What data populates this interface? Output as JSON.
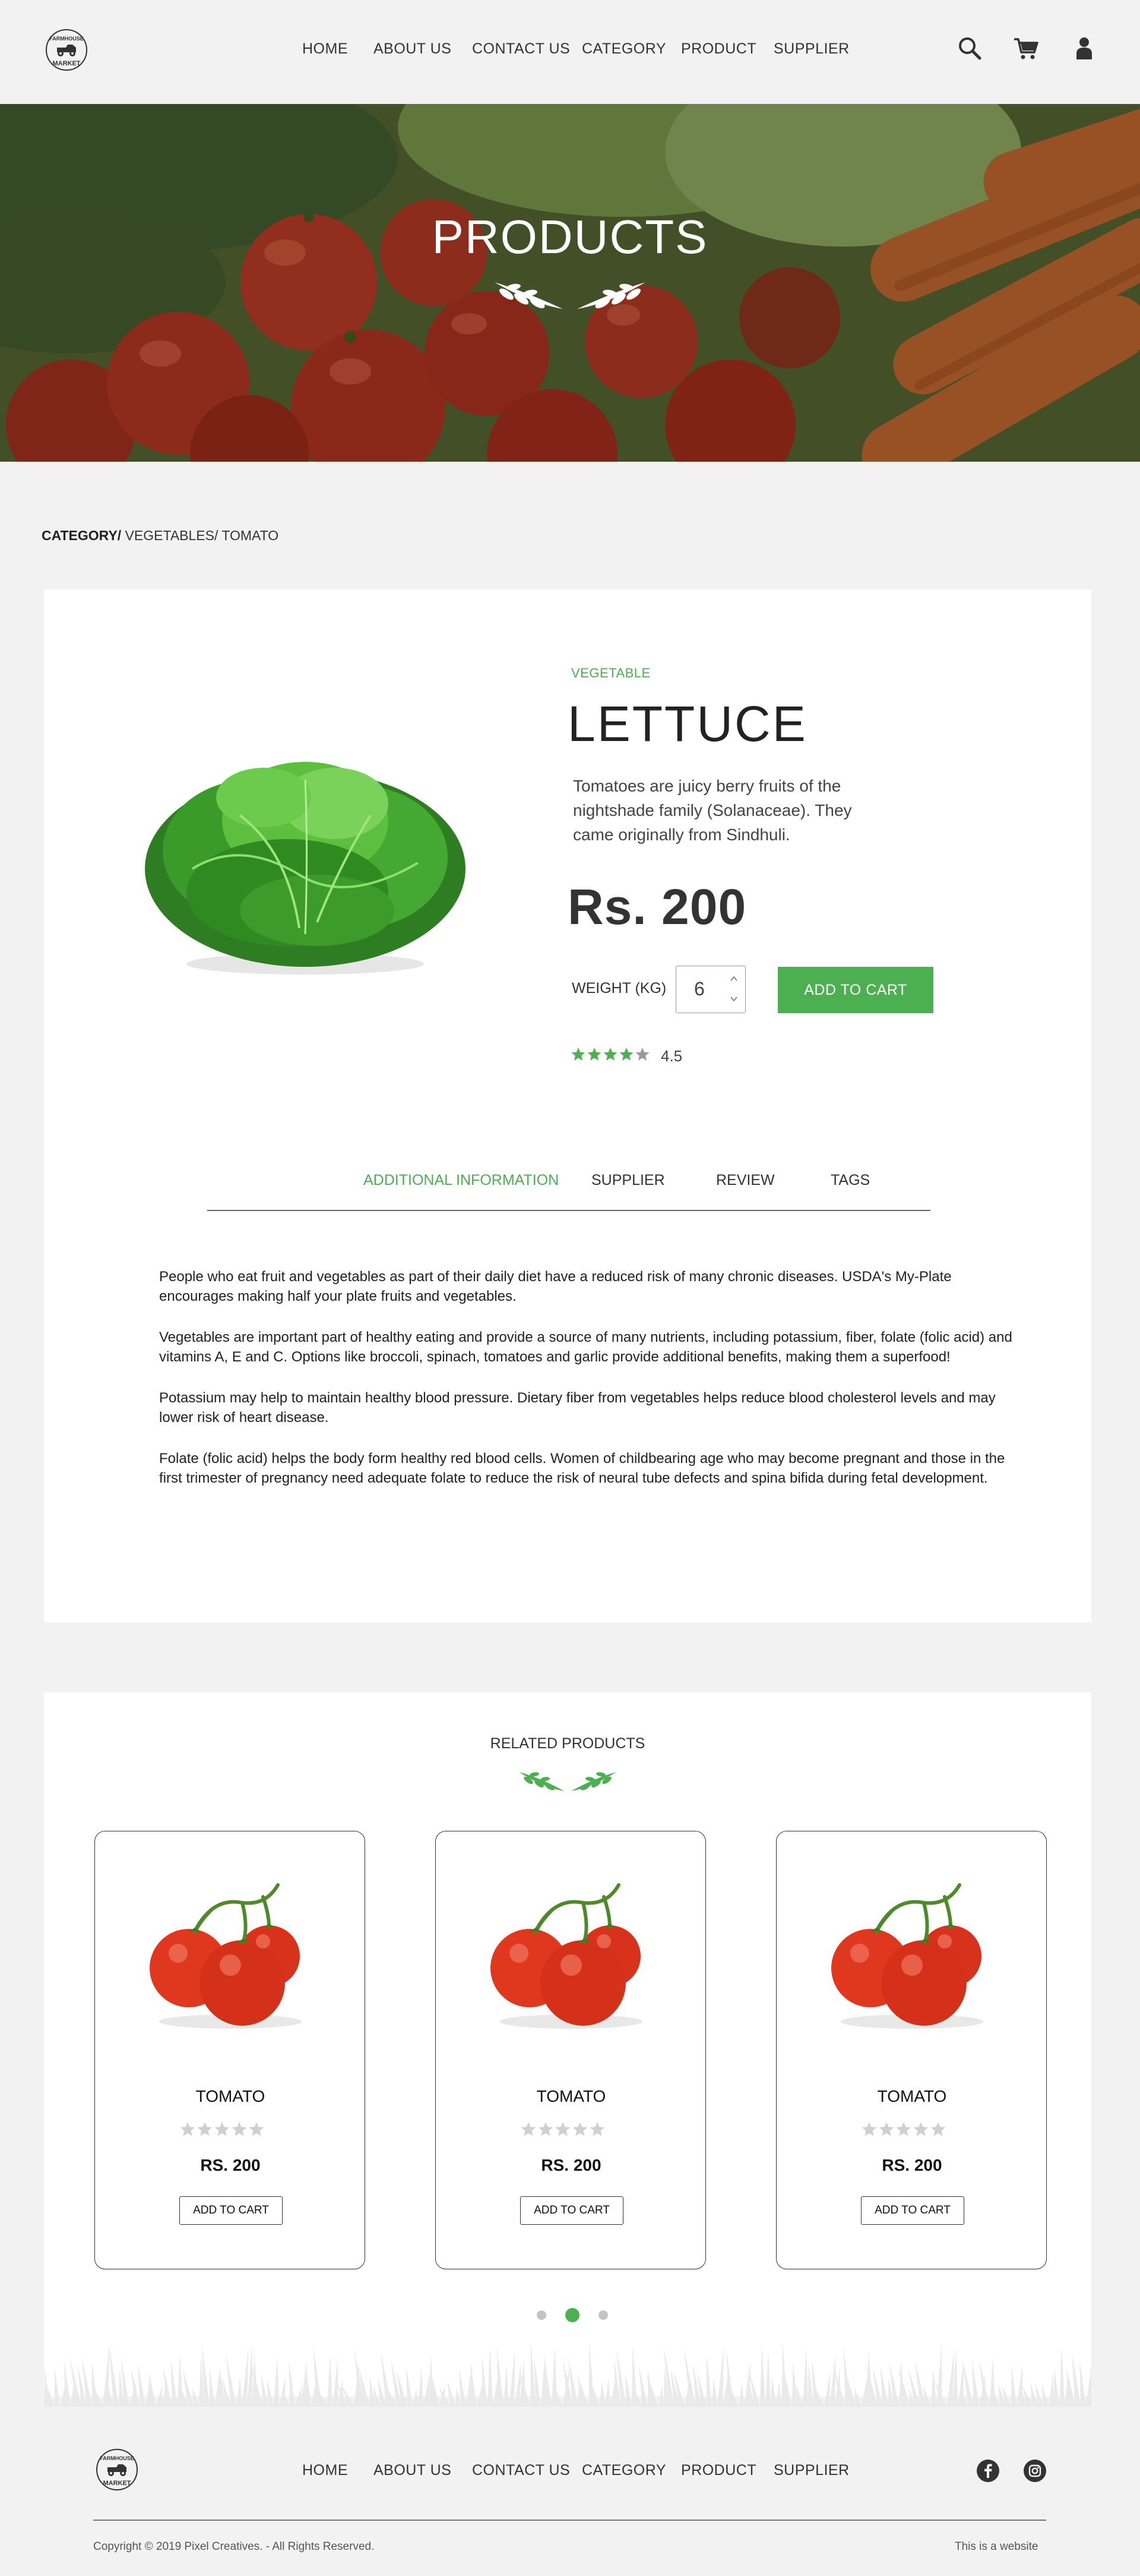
{
  "brand": {
    "logo_text_top": "FARMHOUSE",
    "logo_text_bottom": "MARKET"
  },
  "nav": {
    "home": "HOME",
    "about": "ABOUT US",
    "contact": "CONTACT US",
    "category": "CATEGORY",
    "product": "PRODUCT",
    "supplier": "SUPPLIER"
  },
  "header_icons": [
    "search-icon",
    "cart-icon",
    "user-icon"
  ],
  "hero": {
    "title": "PRODUCTS"
  },
  "breadcrumb": {
    "root": "CATEGORY/",
    "trail": " VEGETABLES/ TOMATO"
  },
  "product": {
    "category": "VEGETABLE",
    "name": "LETTUCE",
    "description": "Tomatoes are juicy berry fruits of the nightshade family (Solanaceae). They came originally from Sindhuli.",
    "price": "Rs. 200",
    "weight_label": "WEIGHT (KG)",
    "quantity": "6",
    "add_to_cart": "ADD TO CART",
    "rating_value": 4.5,
    "rating_text": "4.5"
  },
  "tabs": [
    {
      "label": "ADDITIONAL INFORMATION",
      "active": true
    },
    {
      "label": "SUPPLIER",
      "active": false
    },
    {
      "label": "REVIEW",
      "active": false
    },
    {
      "label": "TAGS",
      "active": false
    }
  ],
  "info_paragraphs": [
    "People who eat fruit and vegetables as part of their daily diet have a reduced risk of many chronic diseases. USDA's My-Plate encourages making half your plate fruits and vegetables.",
    "Vegetables are important part of healthy eating and provide a source of many nutrients, including potassium, fiber, folate (folic acid) and vitamins A, E and C. Options like broccoli, spinach, tomatoes and garlic provide additional benefits, making them a superfood!",
    "Potassium may help to maintain healthy blood pressure. Dietary fiber from vegetables helps reduce blood cholesterol levels and may lower risk of heart disease.",
    "Folate (folic acid) helps the body form healthy red blood cells. Women of childbearing age who may become pregnant and those in the first trimester of pregnancy need adequate folate to reduce the risk of neural tube defects and spina bifida during fetal development."
  ],
  "related": {
    "title": "RELATED PRODUCTS",
    "items": [
      {
        "name": "TOMATO",
        "price": "RS. 200",
        "button": "ADD TO CART",
        "rating_value": 0
      },
      {
        "name": "TOMATO",
        "price": "RS. 200",
        "button": "ADD TO CART",
        "rating_value": 0
      },
      {
        "name": "TOMATO",
        "price": "RS. 200",
        "button": "ADD TO CART",
        "rating_value": 0
      }
    ],
    "carousel_active_page": 2,
    "carousel_pages": 3
  },
  "footer": {
    "social_icons": [
      "facebook-icon",
      "instagram-icon"
    ],
    "copyright": "Copyright © 2019 Pixel Creatives. - All Rights Reserved.",
    "note": "This is a website"
  },
  "colors": {
    "accent": "#4caf50",
    "background": "#f2f2f2",
    "card": "#ffffff",
    "text": "#333333"
  }
}
